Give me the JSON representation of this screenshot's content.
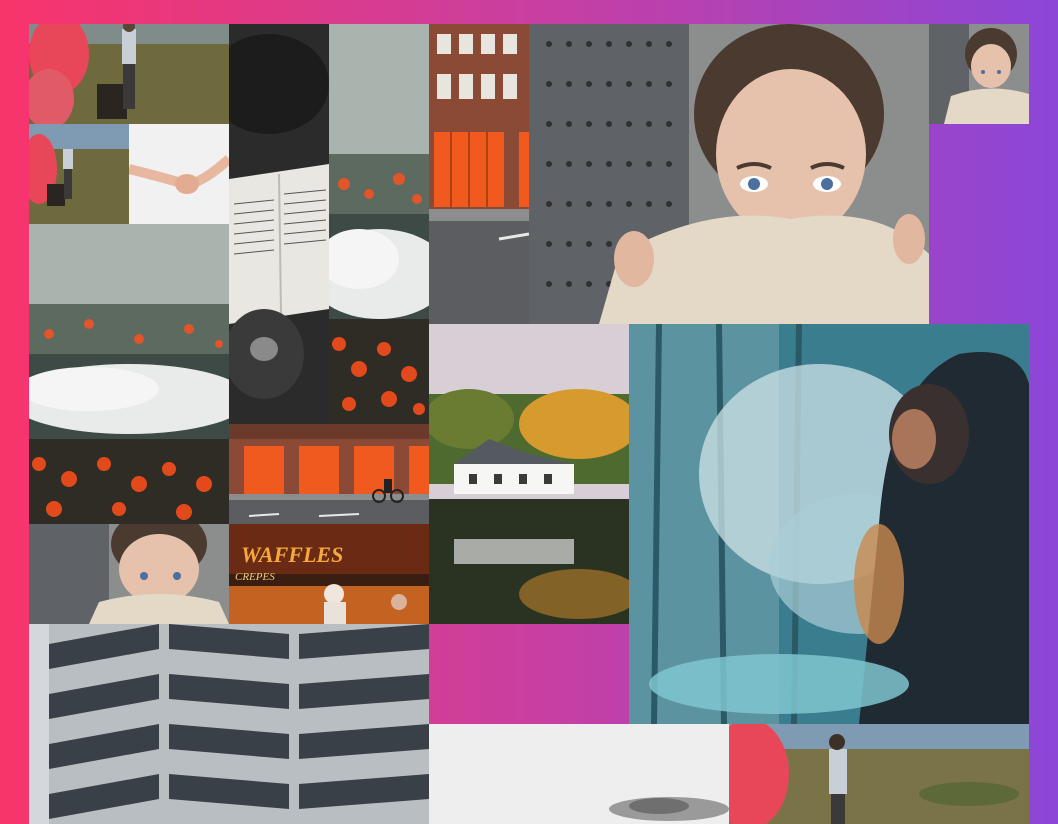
{
  "gallery": {
    "images": [
      {
        "subject": "man-with-red-smoke",
        "alt": ""
      },
      {
        "subject": "open-book",
        "alt": ""
      },
      {
        "subject": "forest-with-clouds",
        "alt": ""
      },
      {
        "subject": "fire-station",
        "alt": ""
      },
      {
        "subject": "woman-with-sweater",
        "alt": ""
      },
      {
        "subject": "woman-with-sweater-small",
        "alt": ""
      },
      {
        "subject": "man-with-red-smoke",
        "alt": ""
      },
      {
        "subject": "holding-hands",
        "alt": ""
      },
      {
        "subject": "forest-with-clouds",
        "alt": ""
      },
      {
        "subject": "lake-house",
        "alt": ""
      },
      {
        "subject": "man-in-smoke",
        "alt": ""
      },
      {
        "subject": "fire-station-cyclist",
        "alt": ""
      },
      {
        "subject": "woman-with-sweater",
        "alt": ""
      },
      {
        "subject": "building-facade",
        "alt": ""
      },
      {
        "subject": "waffles-stand",
        "alt": ""
      },
      {
        "subject": "foggy-hill",
        "alt": ""
      },
      {
        "subject": "man-with-red-smoke",
        "alt": ""
      }
    ],
    "waffles_sign": "WAFFLES",
    "crepes_sign": "CREPES"
  },
  "colors": {
    "gradient_start": "#f8346b",
    "gradient_end": "#8b46d8",
    "smoke_red": "#e8475a",
    "door_orange": "#f05a1e"
  }
}
